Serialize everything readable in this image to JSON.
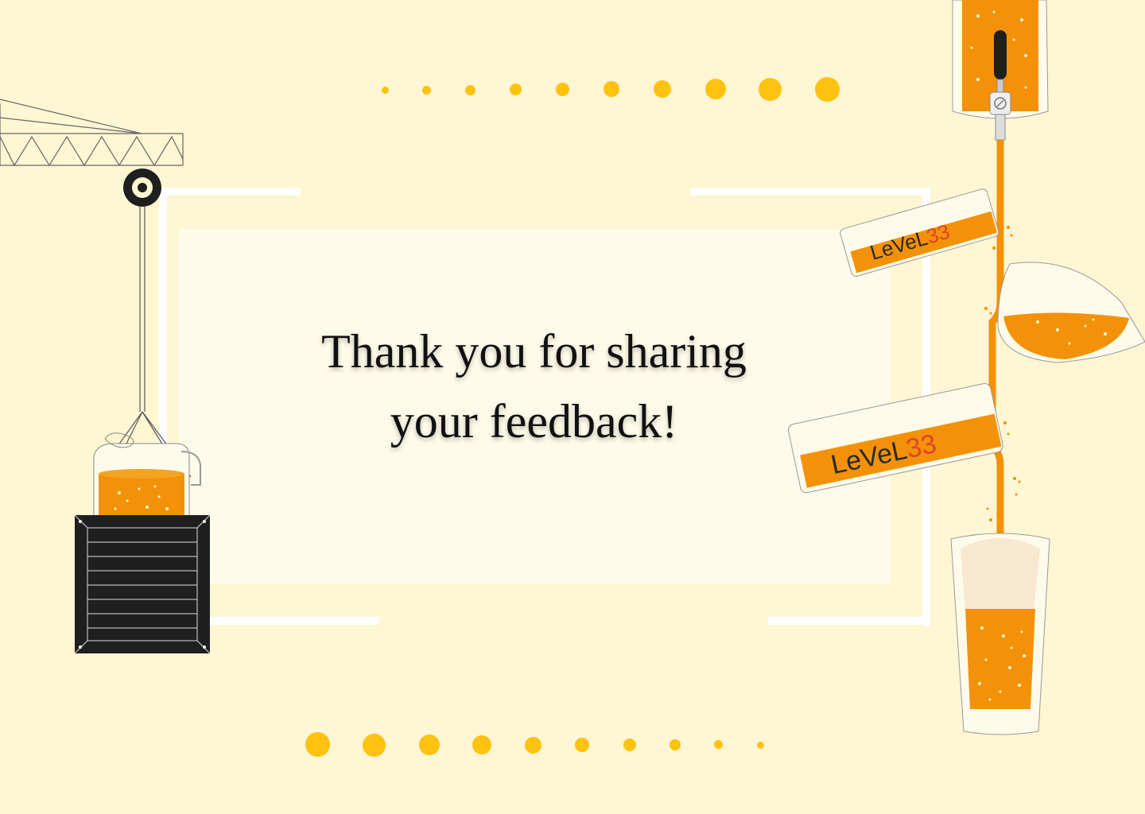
{
  "message": {
    "line1": "Thank you for sharing",
    "line2": "your feedback!"
  },
  "brand": {
    "logo_text": "LeVeL33"
  },
  "colors": {
    "background": "#fff6d3",
    "card": "#fffbea",
    "accent_yellow": "#ffc20e",
    "beer_orange": "#f39208",
    "logo_number_red": "#e0442a",
    "crate_black": "#1f1f1f"
  },
  "decorations": {
    "top_dots": "yellow-dot-row",
    "bottom_dots": "yellow-dot-row",
    "left_illustration": "crane-lifting-beer-crate",
    "right_illustration": "beer-tap-pouring-glasses"
  }
}
